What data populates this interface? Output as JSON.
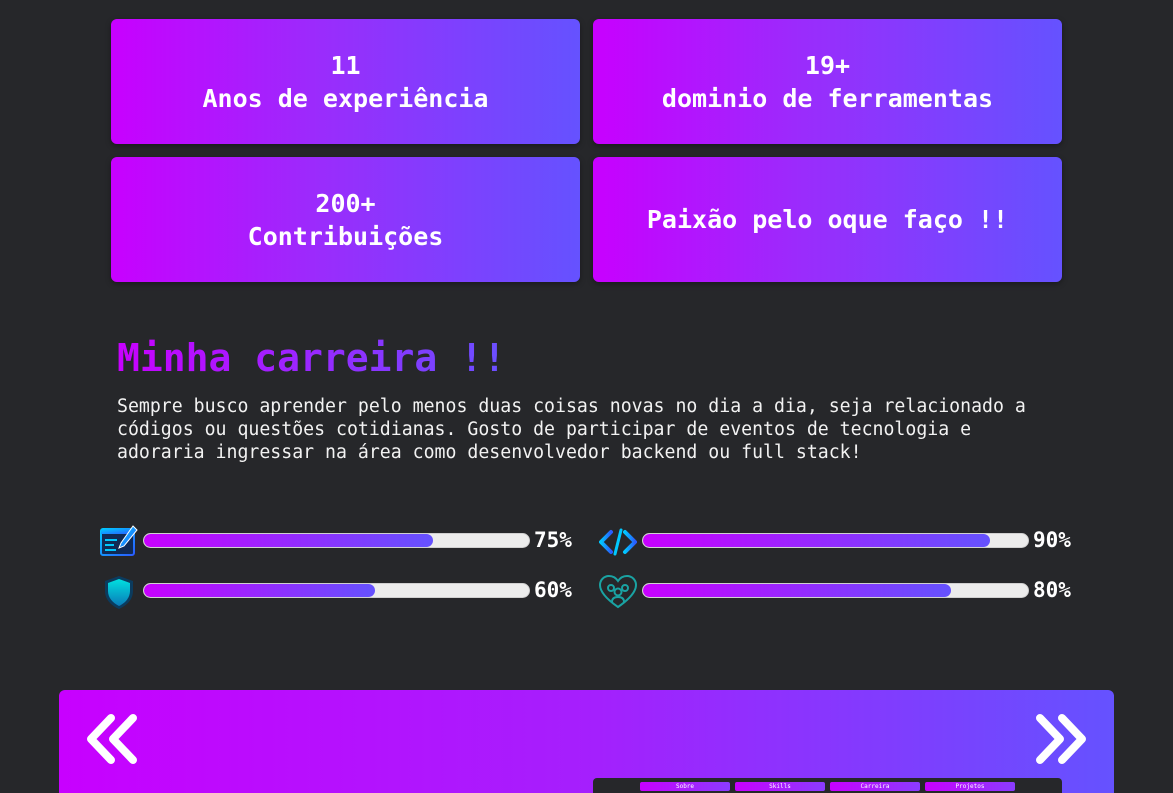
{
  "stats": [
    {
      "value": "11",
      "label": "Anos de experiência"
    },
    {
      "value": "19+",
      "label": "dominio de ferramentas"
    },
    {
      "value": "200+",
      "label": "Contribuições"
    },
    {
      "value": "",
      "label": "Paixão pelo oque faço !!"
    }
  ],
  "career": {
    "title": "Minha carreira !!",
    "text": "Sempre busco aprender pelo menos duas coisas novas no dia a dia, seja relacionado a códigos ou questões cotidianas. Gosto de participar de eventos de tecnologia e adoraria ingressar na área como desenvolvedor backend ou full stack!"
  },
  "skills": [
    {
      "icon": "design-editor-icon",
      "percent": 75,
      "label": "75%"
    },
    {
      "icon": "code-icon",
      "percent": 90,
      "label": "90%"
    },
    {
      "icon": "shield-icon",
      "percent": 60,
      "label": "60%"
    },
    {
      "icon": "team-heart-icon",
      "percent": 80,
      "label": "80%"
    }
  ],
  "carousel": {
    "prev_icon": "double-chevron-left-icon",
    "next_icon": "double-chevron-right-icon",
    "preview_nav": [
      "Sobre",
      "Skills",
      "Carreira",
      "Projetos"
    ]
  },
  "colors": {
    "background": "#26272a",
    "gradient_start": "#c800ff",
    "gradient_end": "#6552ff"
  }
}
